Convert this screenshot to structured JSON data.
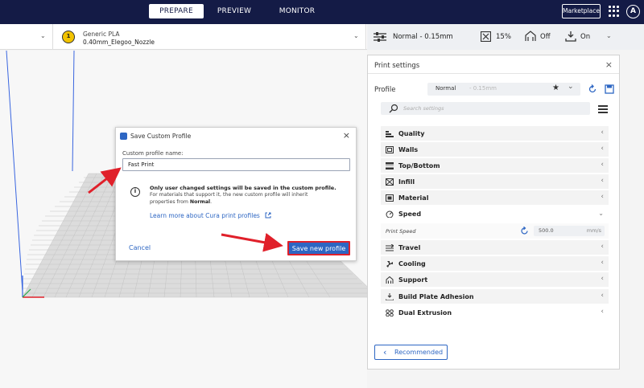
{
  "header": {
    "tabs": [
      "PREPARE",
      "PREVIEW",
      "MONITOR"
    ],
    "active_tab": "PREPARE",
    "marketplace_label": "Marketplace",
    "account_initial": "A"
  },
  "material": {
    "badge": "1",
    "name": "Generic PLA",
    "nozzle": "0.40mm_Elegoo_Nozzle"
  },
  "settings_bar": {
    "profile": "Normal - 0.15mm",
    "infill": "15%",
    "support": "Off",
    "adhesion": "On"
  },
  "panel": {
    "title": "Print settings",
    "profile_label": "Profile",
    "profile_name": "Normal",
    "profile_sub": "- 0.15mm",
    "search_placeholder": "Search settings",
    "categories": [
      {
        "icon": "quality-icon",
        "label": "Quality"
      },
      {
        "icon": "walls-icon",
        "label": "Walls"
      },
      {
        "icon": "top-bottom-icon",
        "label": "Top/Bottom"
      },
      {
        "icon": "infill-icon",
        "label": "Infill"
      },
      {
        "icon": "material-icon",
        "label": "Material"
      },
      {
        "icon": "speed-icon",
        "label": "Speed"
      },
      {
        "icon": "travel-icon",
        "label": "Travel"
      },
      {
        "icon": "cooling-icon",
        "label": "Cooling"
      },
      {
        "icon": "support-icon",
        "label": "Support"
      },
      {
        "icon": "build-plate-icon",
        "label": "Build Plate Adhesion"
      },
      {
        "icon": "dual-extrusion-icon",
        "label": "Dual Extrusion"
      }
    ],
    "print_speed": {
      "label": "Print Speed",
      "value": "500.0",
      "unit": "mm/s"
    },
    "recommended_label": "Recommended"
  },
  "dialog": {
    "title": "Save Custom Profile",
    "field_label": "Custom profile name:",
    "field_value": "Fast Print",
    "info_bold": "Only user changed settings will be saved in the custom profile.",
    "info_line2": "For materials that support it, the new custom profile will inherit",
    "info_line3_prefix": "properties from ",
    "info_line3_bold": "Normal",
    "info_line3_suffix": ".",
    "learn_link": "Learn more about Cura print profiles",
    "cancel_label": "Cancel",
    "save_label": "Save new profile"
  },
  "colors": {
    "header_bg": "#141b46",
    "accent": "#2d66c3",
    "highlight": "#e0202a",
    "material_badge": "#f2c300"
  }
}
